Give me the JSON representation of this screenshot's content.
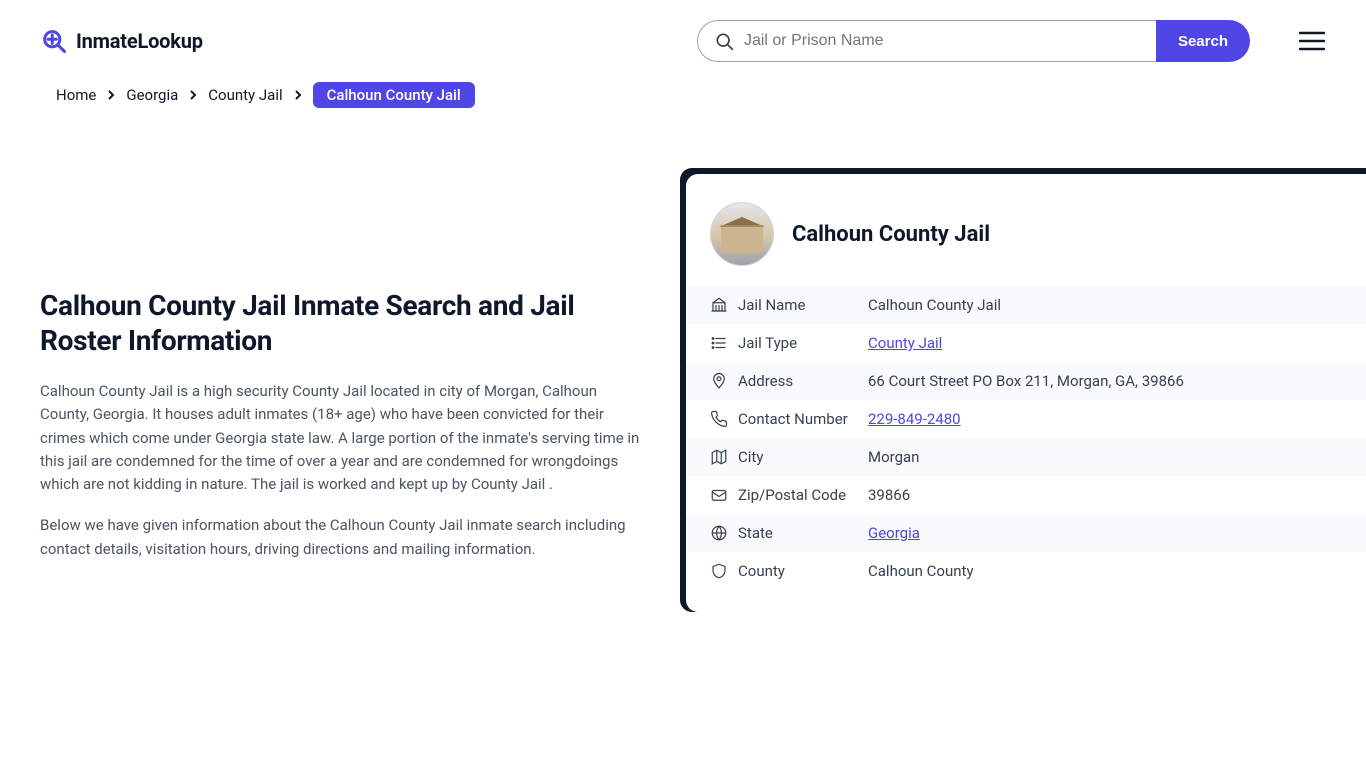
{
  "header": {
    "logo_text": "InmateLookup",
    "search_placeholder": "Jail or Prison Name",
    "search_button": "Search"
  },
  "breadcrumb": {
    "items": [
      "Home",
      "Georgia",
      "County Jail"
    ],
    "current": "Calhoun County Jail"
  },
  "main": {
    "heading": "Calhoun County Jail Inmate Search and Jail Roster Information",
    "p1": "Calhoun County Jail is a high security County Jail located in city of Morgan, Calhoun County, Georgia. It houses adult inmates (18+ age) who have been convicted for their crimes which come under Georgia state law. A large portion of the inmate's serving time in this jail are condemned for the time of over a year and are condemned for wrongdoings which are not kidding in nature. The jail is worked and kept up by County Jail .",
    "p2": "Below we have given information about the Calhoun County Jail inmate search including contact details, visitation hours, driving directions and mailing information."
  },
  "card": {
    "title": "Calhoun County Jail",
    "rows": [
      {
        "icon": "building",
        "label": "Jail Name",
        "value": "Calhoun County Jail",
        "link": false
      },
      {
        "icon": "list",
        "label": "Jail Type",
        "value": "County Jail",
        "link": true
      },
      {
        "icon": "pin",
        "label": "Address",
        "value": "66 Court Street PO Box 211, Morgan, GA, 39866",
        "link": false
      },
      {
        "icon": "phone",
        "label": "Contact Number",
        "value": "229-849-2480",
        "link": true
      },
      {
        "icon": "map",
        "label": "City",
        "value": "Morgan",
        "link": false
      },
      {
        "icon": "mail",
        "label": "Zip/Postal Code",
        "value": "39866",
        "link": false
      },
      {
        "icon": "globe",
        "label": "State",
        "value": "Georgia",
        "link": true
      },
      {
        "icon": "shield",
        "label": "County",
        "value": "Calhoun County",
        "link": false
      }
    ]
  }
}
